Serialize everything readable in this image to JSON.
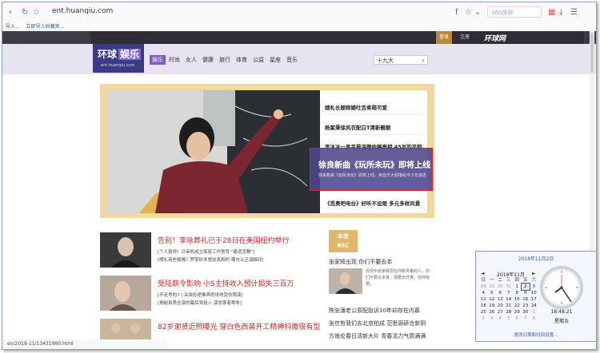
{
  "browser": {
    "url": "ent.huanqiu.com",
    "search_placeholder": "360搜索",
    "bookmark_text": "导入...",
    "bookmark_link": "立即导入收藏夹..."
  },
  "site_top": {
    "login": "登录",
    "register": "注册",
    "hq_logo": "环球网"
  },
  "logo": {
    "main": "环球",
    "ent": "娱乐",
    "sub": "ent.huanqiu.com"
  },
  "nav": {
    "items": [
      "娱乐",
      "时尚",
      "女人",
      "健康",
      "旅行",
      "体育",
      "公益",
      "星座",
      "音乐"
    ],
    "search_value": "十九大",
    "search_icon": "search-icon"
  },
  "featured": {
    "list": [
      "嫂札长颖称婚吐舌卖萌可爱",
      "杨紫秉徐风衣配白T清新靓丽",
      "李冰冰一男吊带温暖依稀亮相 45岁的风韵",
      "《觅奥吧电台》好听不设限 多元多样风景"
    ],
    "overlay_title": "徐良新曲《玩所未玩》即将上线",
    "overlay_sub": "徐良新曲《玩所未玩》即将上线，用音乐大胆描绘今少年姿态"
  },
  "news": [
    {
      "title": "告别！李咏葬礼已于28日在美国纽约举行",
      "sub1": "[个人独领！日审机成立家庭工作室背 \"霸道舌鞘\"]",
      "sub2": "[哪礼用些娱嘴？罗掌好本想这真相时 哪也认正演瞬间]"
    },
    {
      "title": "受陆薪令影响 小S主持收入预计损失三百万",
      "sub1": "[不走考的7 | 关晓彤遮推弄的场地受仿照演]",
      "sub2": "[揭秘真秀全演的幕后驾投入 演发客者零条]"
    },
    {
      "title": "82岁谢贤近照曝光 穿白色西装开工精神抖擞很有型",
      "sub1": "",
      "sub2": ""
    }
  ],
  "side": {
    "logo_line1": "本老",
    "logo_line2": "娱乐汇",
    "title": "张家辉出现 你们不要去本",
    "desc": "侃侃中张家辉现在你新风格的人，你们不要在本身，把要去开爽，完伴哈要。",
    "links": [
      "陈张潘老公原配投诉10年却存在内慕",
      "张信哲我们去北京拍成 范思源研合新阴",
      "方逸伦春日清新大片 青春活力气质满满"
    ]
  },
  "status_bar": "en/2018-11/13431980.html",
  "calendar": {
    "date_header": "2018年11月2日",
    "month_label": "2018年11月",
    "prev": "◄",
    "next": "►",
    "weekdays": [
      "日",
      "一",
      "二",
      "三",
      "四",
      "五",
      "六"
    ],
    "days": [
      {
        "d": "28",
        "m": true
      },
      {
        "d": "29",
        "m": true
      },
      {
        "d": "30",
        "m": true
      },
      {
        "d": "31",
        "m": true
      },
      {
        "d": "1",
        "m": false
      },
      {
        "d": "2",
        "m": false,
        "today": true
      },
      {
        "d": "3",
        "m": false
      },
      {
        "d": "4",
        "m": false
      },
      {
        "d": "5",
        "m": false
      },
      {
        "d": "6",
        "m": false
      },
      {
        "d": "7",
        "m": false
      },
      {
        "d": "8",
        "m": false
      },
      {
        "d": "9",
        "m": false
      },
      {
        "d": "10",
        "m": false
      },
      {
        "d": "11",
        "m": false
      },
      {
        "d": "12",
        "m": false
      },
      {
        "d": "13",
        "m": false
      },
      {
        "d": "14",
        "m": false
      },
      {
        "d": "15",
        "m": false
      },
      {
        "d": "16",
        "m": false
      },
      {
        "d": "17",
        "m": false
      },
      {
        "d": "18",
        "m": false
      },
      {
        "d": "19",
        "m": false
      },
      {
        "d": "20",
        "m": false
      },
      {
        "d": "21",
        "m": false
      },
      {
        "d": "22",
        "m": false
      },
      {
        "d": "23",
        "m": false
      },
      {
        "d": "24",
        "m": false
      },
      {
        "d": "25",
        "m": false
      },
      {
        "d": "26",
        "m": false
      },
      {
        "d": "27",
        "m": false
      },
      {
        "d": "28",
        "m": false
      },
      {
        "d": "29",
        "m": false
      },
      {
        "d": "30",
        "m": false
      },
      {
        "d": "1",
        "m": true
      },
      {
        "d": "2",
        "m": true
      },
      {
        "d": "3",
        "m": true
      },
      {
        "d": "4",
        "m": true
      },
      {
        "d": "5",
        "m": true
      },
      {
        "d": "6",
        "m": true
      },
      {
        "d": "7",
        "m": true
      },
      {
        "d": "8",
        "m": true
      }
    ],
    "time": "18:48:21",
    "weekday": "星期五",
    "link": "更改日期和时间设置..."
  }
}
